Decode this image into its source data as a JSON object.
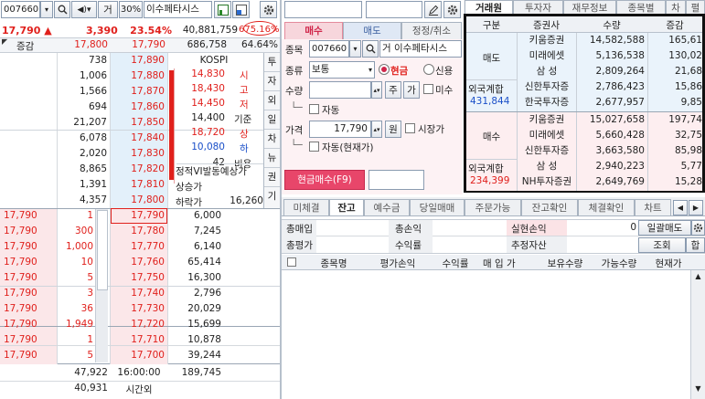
{
  "toolbar": {
    "code": "007660",
    "mode": "거",
    "pct": "30%",
    "name": "이수페타시스"
  },
  "quote": {
    "price": "17,790",
    "arrow": "▲",
    "change": "3,390",
    "rate": "23.54%",
    "volume": "40,881,759",
    "turnover": "675.16%"
  },
  "hdr": {
    "label": "증감",
    "price1": "17,800",
    "price2": "17,790",
    "vol": "686,758",
    "pct": "64.64%"
  },
  "ask_rows": [
    {
      "qty": "738",
      "price": "17,890"
    },
    {
      "qty": "1,006",
      "price": "17,880"
    },
    {
      "qty": "1,566",
      "price": "17,870"
    },
    {
      "qty": "694",
      "price": "17,860"
    },
    {
      "qty": "21,207",
      "price": "17,850"
    },
    {
      "qty": "6,078",
      "price": "17,840"
    },
    {
      "qty": "2,020",
      "price": "17,830"
    },
    {
      "qty": "8,865",
      "price": "17,820"
    },
    {
      "qty": "1,391",
      "price": "17,810"
    },
    {
      "qty": "4,357",
      "price": "17,800"
    }
  ],
  "kospi": {
    "title": "KOSPI",
    "items": [
      {
        "v": "14,830",
        "l": "시"
      },
      {
        "v": "18,430",
        "l": "고"
      },
      {
        "v": "14,450",
        "l": "저"
      },
      {
        "v": "14,400",
        "l": "기준"
      },
      {
        "v": "18,720",
        "l": "상"
      },
      {
        "v": "10,080",
        "l": "하"
      }
    ],
    "ratio_v": "42",
    "ratio_l": "비용",
    "notice": "정적VI발동예상가",
    "up_l": "상승가",
    "down_l": "하락가",
    "down_v": "16,260"
  },
  "side_tabs": [
    "투",
    "자",
    "외",
    "일",
    "차",
    "뉴",
    "권",
    "기"
  ],
  "bid_rows": [
    {
      "p": "17,790",
      "q": "1",
      "price": "17,790",
      "vol": "6,000"
    },
    {
      "p": "17,790",
      "q": "300",
      "price": "17,780",
      "vol": "7,245"
    },
    {
      "p": "17,790",
      "q": "1,000",
      "price": "17,770",
      "vol": "6,140"
    },
    {
      "p": "17,790",
      "q": "10",
      "price": "17,760",
      "vol": "65,414"
    },
    {
      "p": "17,790",
      "q": "5",
      "price": "17,750",
      "vol": "16,300"
    },
    {
      "p": "17,790",
      "q": "3",
      "price": "17,740",
      "vol": "2,796"
    },
    {
      "p": "17,790",
      "q": "36",
      "price": "17,730",
      "vol": "20,029"
    },
    {
      "p": "17,790",
      "q": "1,949",
      "price": "17,720",
      "vol": "15,699"
    },
    {
      "p": "17,790",
      "q": "1",
      "price": "17,710",
      "vol": "10,878"
    },
    {
      "p": "17,790",
      "q": "5",
      "price": "17,700",
      "vol": "39,244"
    }
  ],
  "footer": {
    "ask_total": "47,922",
    "time": "16:00:00",
    "bid_total": "189,745",
    "after": "40,931",
    "after_label": "시간외"
  },
  "order": {
    "tabs": [
      "매수",
      "매도",
      "정정/취소"
    ],
    "code_label": "종목",
    "code": "007660",
    "mode": "거",
    "name": "이수페타시스",
    "kind_label": "종류",
    "kind": "보통",
    "cash": "현금",
    "credit": "신용",
    "qty_label": "수량",
    "jusu": "주",
    "ga": "가",
    "misu": "미수",
    "auto": "자동",
    "price_label": "가격",
    "price": "17,790",
    "won": "원",
    "market": "시장가",
    "auto2": "자동(현재가)",
    "submit": "현금매수(F9)"
  },
  "right_tabs": [
    "거래원",
    "투자자",
    "재무정보",
    "종목별",
    "차",
    "펼"
  ],
  "broker": {
    "headers": [
      "구분",
      "증권사",
      "수량",
      "증감"
    ],
    "sell": {
      "label": "매도",
      "rows": [
        {
          "n": "키움증권",
          "q": "14,582,588",
          "d": "165,61"
        },
        {
          "n": "미래에셋",
          "q": "5,136,538",
          "d": "130,02"
        },
        {
          "n": "삼  성",
          "q": "2,809,264",
          "d": "21,68"
        },
        {
          "n": "신한투자증",
          "q": "2,786,423",
          "d": "15,86"
        },
        {
          "n": "한국투자증",
          "q": "2,677,957",
          "d": "9,85"
        }
      ]
    },
    "buy": {
      "label": "매수",
      "rows": [
        {
          "n": "키움증권",
          "q": "15,027,658",
          "d": "197,74"
        },
        {
          "n": "미래에셋",
          "q": "5,660,428",
          "d": "32,75"
        },
        {
          "n": "신한투자증",
          "q": "3,663,580",
          "d": "85,98"
        },
        {
          "n": "삼  성",
          "q": "2,940,223",
          "d": "5,77"
        },
        {
          "n": "NH투자증권",
          "q": "2,649,769",
          "d": "15,28"
        }
      ]
    },
    "foreign_label": "외국계합",
    "foreign_sell": "431,844",
    "foreign_buy": "234,399"
  },
  "balance": {
    "tabs": [
      "미체결",
      "잔고",
      "예수금",
      "당일매매",
      "주문가능",
      "잔고확인",
      "체결확인",
      "차트"
    ],
    "r1": [
      "총매입",
      "총손익",
      "실현손익",
      "0",
      "일괄매도"
    ],
    "r2": [
      "총평가",
      "수익률",
      "추정자산",
      "조회",
      "합"
    ],
    "cols": [
      "종목명",
      "평가손익",
      "수익률",
      "매 입 가",
      "보유수량",
      "가능수량",
      "현재가"
    ]
  },
  "colors": {
    "up": "#e0201c",
    "down": "#1a4fc8",
    "ask_bg": "#e3f0fa",
    "bid_bg": "#fbe7e9",
    "submit": "#e8466a"
  }
}
